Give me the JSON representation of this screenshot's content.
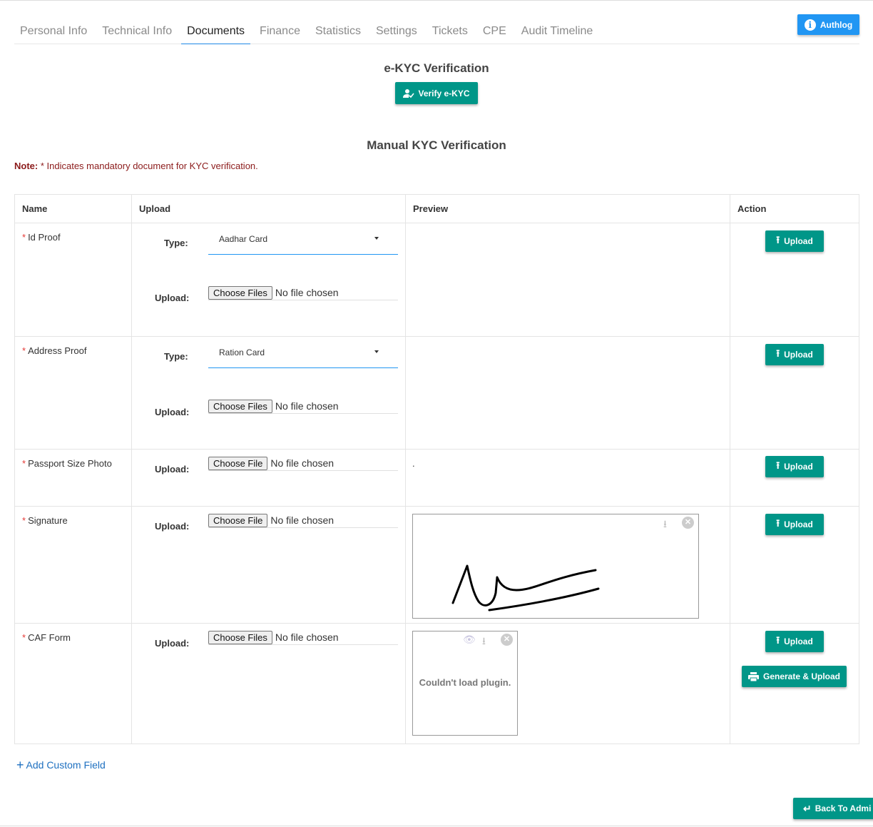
{
  "tabs": [
    "Personal Info",
    "Technical Info",
    "Documents",
    "Finance",
    "Statistics",
    "Settings",
    "Tickets",
    "CPE",
    "Audit Timeline"
  ],
  "authlog_label": "Authlog",
  "ekyc": {
    "title": "e-KYC Verification",
    "button": "Verify e-KYC"
  },
  "manual": {
    "title": "Manual KYC Verification"
  },
  "note": {
    "label": "Note:",
    "text": "* Indicates mandatory document for KYC verification."
  },
  "table": {
    "headers": [
      "Name",
      "Upload",
      "Preview",
      "Action"
    ],
    "type_label": "Type:",
    "upload_label": "Upload:",
    "action_label": "Upload",
    "generate_label": "Generate & Upload",
    "rows": [
      {
        "name": "Id Proof",
        "type": "Aadhar Card",
        "file_button": "Choose Files",
        "file_status": "No file chosen"
      },
      {
        "name": "Address Proof",
        "type": "Ration Card",
        "file_button": "Choose Files",
        "file_status": "No file chosen"
      },
      {
        "name": "Passport Size Photo",
        "file_button": "Choose File",
        "file_status": "No file chosen",
        "preview_text": "."
      },
      {
        "name": "Signature",
        "file_button": "Choose File",
        "file_status": "No file chosen"
      },
      {
        "name": "CAF Form",
        "file_button": "Choose Files",
        "file_status": "No file chosen",
        "preview_text": "Couldn't load plugin."
      }
    ]
  },
  "add_custom": "Add Custom Field",
  "back_button": "Back To Admi",
  "icons": {
    "authlog": "info-icon",
    "verify": "user-check-icon",
    "upload": "upload-icon",
    "generate": "printer-icon",
    "preview_download": "download-icon",
    "preview_close": "close-circle-icon",
    "preview_view": "eye-icon",
    "add": "plus-icon",
    "back": "return-arrow-icon"
  },
  "colors": {
    "teal": "#009688",
    "blue": "#2196f3",
    "note": "#8b1a1a",
    "required": "#e53935"
  }
}
